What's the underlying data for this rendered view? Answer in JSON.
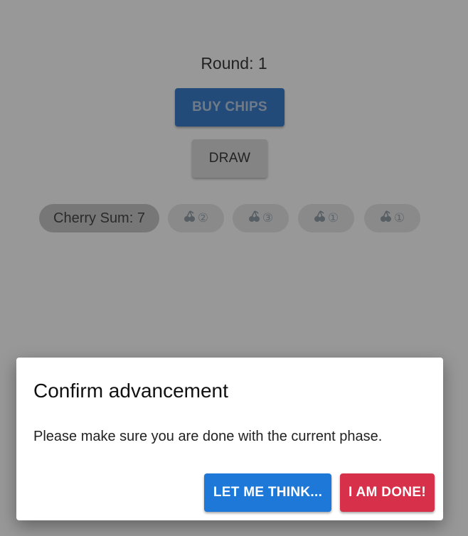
{
  "header": {
    "round_label": "Round: 1"
  },
  "actions": {
    "buy_chips": "BUY CHIPS",
    "draw": "DRAW"
  },
  "chips": {
    "sum_label": "Cherry Sum: 7",
    "cherries": [
      {
        "icon": "cherry-icon",
        "value": "②"
      },
      {
        "icon": "cherry-icon",
        "value": "③"
      },
      {
        "icon": "cherry-icon",
        "value": "①"
      },
      {
        "icon": "cherry-icon",
        "value": "①"
      }
    ]
  },
  "dialog": {
    "title": "Confirm advancement",
    "message": "Please make sure you are done with the current phase.",
    "cancel_label": "LET ME THINK...",
    "confirm_label": "I AM DONE!"
  },
  "colors": {
    "primary": "#1e78d8",
    "danger": "#d6304a",
    "overlay": "rgba(50,50,50,0.5)"
  }
}
